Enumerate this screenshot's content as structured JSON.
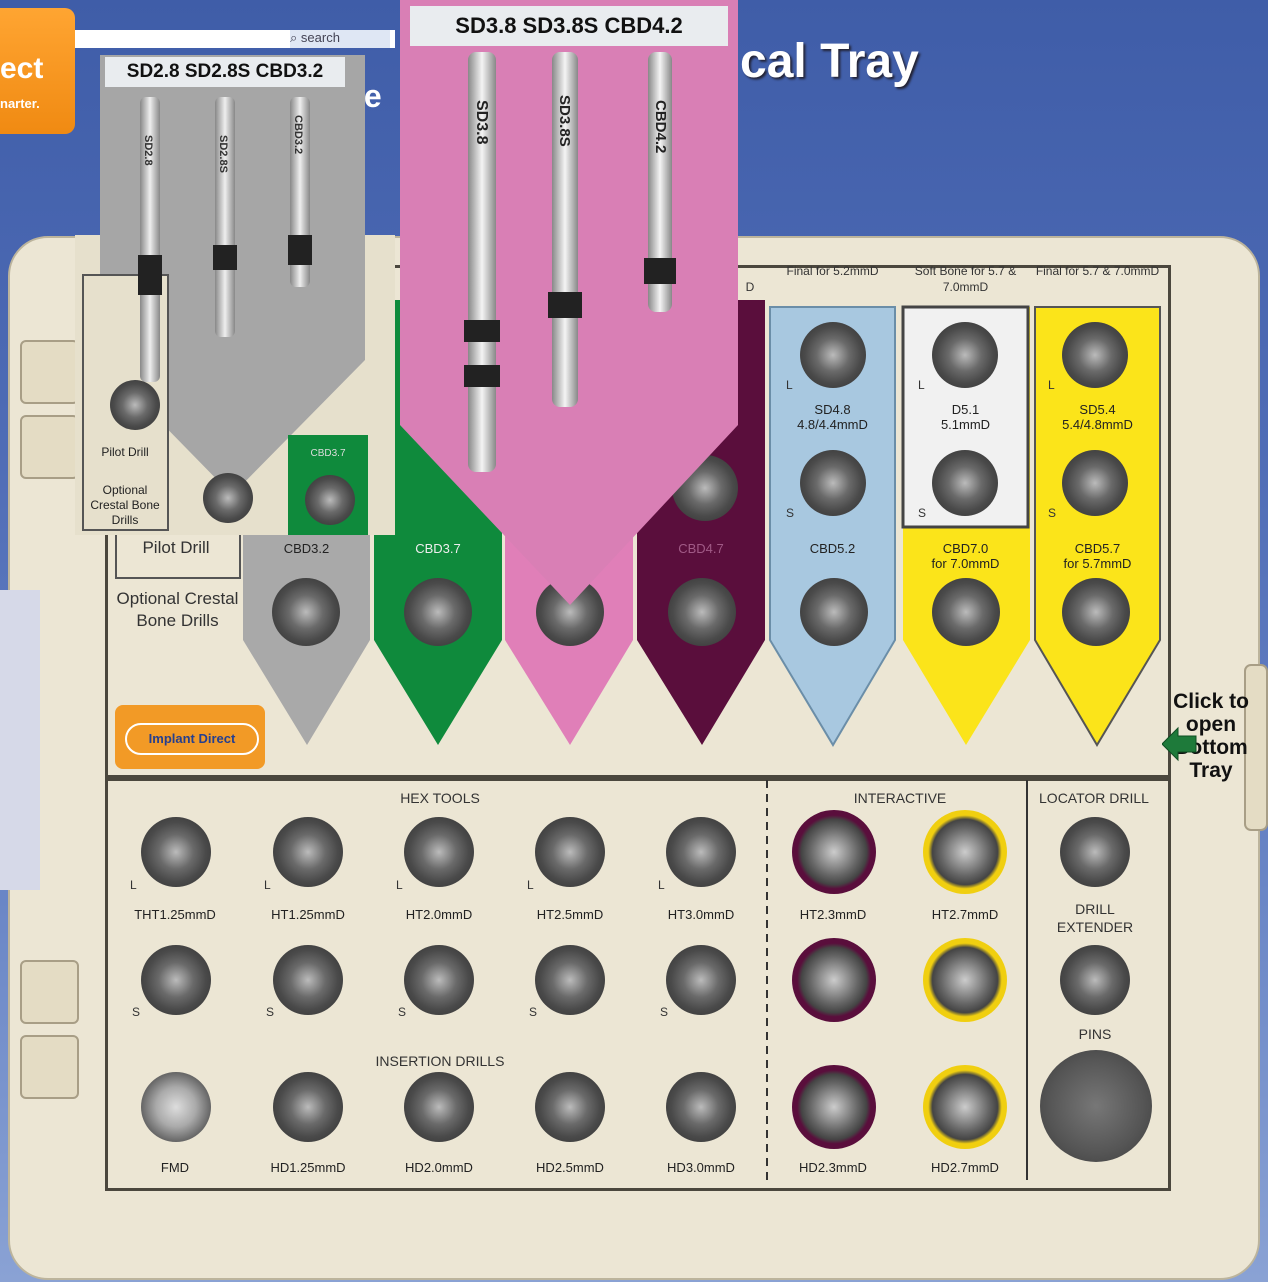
{
  "header": {
    "logo_text": "ect",
    "logo_tagline": "narter.",
    "search_label": "search",
    "title_fragment": "cal Tray",
    "subtitle_fragment": "le"
  },
  "upper_tray": {
    "columns": [
      {
        "id": "pilot",
        "label": "Pilot Drill",
        "sublabel": "Optional Crestal Bone Drills",
        "color": "#ece6d4"
      },
      {
        "id": "sd28",
        "bottom_label": "CBD3.2",
        "color": "#a9a9a9"
      },
      {
        "id": "sd32",
        "bottom_label": "CBD3.7",
        "color": "#0f8a3c"
      },
      {
        "id": "sd38",
        "bottom_label": "CBD4.2",
        "color": "#e07fb8"
      },
      {
        "id": "sd42",
        "bottom_label": "CBD4.7",
        "color": "#5a0e3c"
      },
      {
        "id": "sd48",
        "top": "Final for 5.2mmD",
        "mid": "SD4.8",
        "mid2": "4.8/4.4mmD",
        "bottom_label": "CBD5.2",
        "color": "#a8c8e0"
      },
      {
        "id": "d51",
        "top": "Soft Bone for 5.7 & 7.0mmD",
        "mid": "D5.1",
        "mid2": "5.1mmD",
        "bottom_label": "CBD7.0",
        "bottom_label2": "for 7.0mmD",
        "color": "#f1f1f1"
      },
      {
        "id": "sd54",
        "top": "Final for 5.7 & 7.0mmD",
        "mid": "SD5.4",
        "mid2": "5.4/4.8mmD",
        "bottom_label": "CBD5.7",
        "bottom_label2": "for 5.7mmD",
        "color": "#fbe41a"
      }
    ],
    "top_partial_label": "D",
    "size_marks": {
      "L": "L",
      "S": "S"
    }
  },
  "lower_tray": {
    "hex_tools_label": "HEX TOOLS",
    "insertion_drills_label": "INSERTION DRILLS",
    "interactive_label": "INTERACTIVE",
    "locator_label": "LOCATOR DRILL",
    "extender_label": "DRILL EXTENDER",
    "pins_label": "PINS",
    "row1": [
      "THT1.25mmD",
      "HT1.25mmD",
      "HT2.0mmD",
      "HT2.5mmD",
      "HT3.0mmD",
      "HT2.3mmD",
      "HT2.7mmD"
    ],
    "row3": [
      "FMD",
      "HD1.25mmD",
      "HD2.0mmD",
      "HD2.5mmD",
      "HD3.0mmD",
      "HD2.3mmD",
      "HD2.7mmD"
    ]
  },
  "side_control": {
    "click_label": "Click to open Bottom Tray"
  },
  "brand_badge": {
    "text": "Implant Direct"
  },
  "popup_gray": {
    "title": "SD2.8  SD2.8S  CBD3.2",
    "drills": [
      "SD2.8",
      "SD2.8S",
      "CBD3.2"
    ],
    "bottom_labels": [
      "Pilot Drill",
      "Optional Crestal Bone Drills"
    ],
    "small_label": "CBD3.7"
  },
  "popup_pink": {
    "title": "SD3.8  SD3.8S  CBD4.2",
    "drills": [
      "SD3.8",
      "SD3.8S",
      "CBD4.2"
    ]
  },
  "colors": {
    "accent": "#f29a26",
    "pink": "#d97fb5",
    "gray_popup": "#a6a6a6",
    "tray": "#ece6d4",
    "bg": "#4f6cb6"
  }
}
